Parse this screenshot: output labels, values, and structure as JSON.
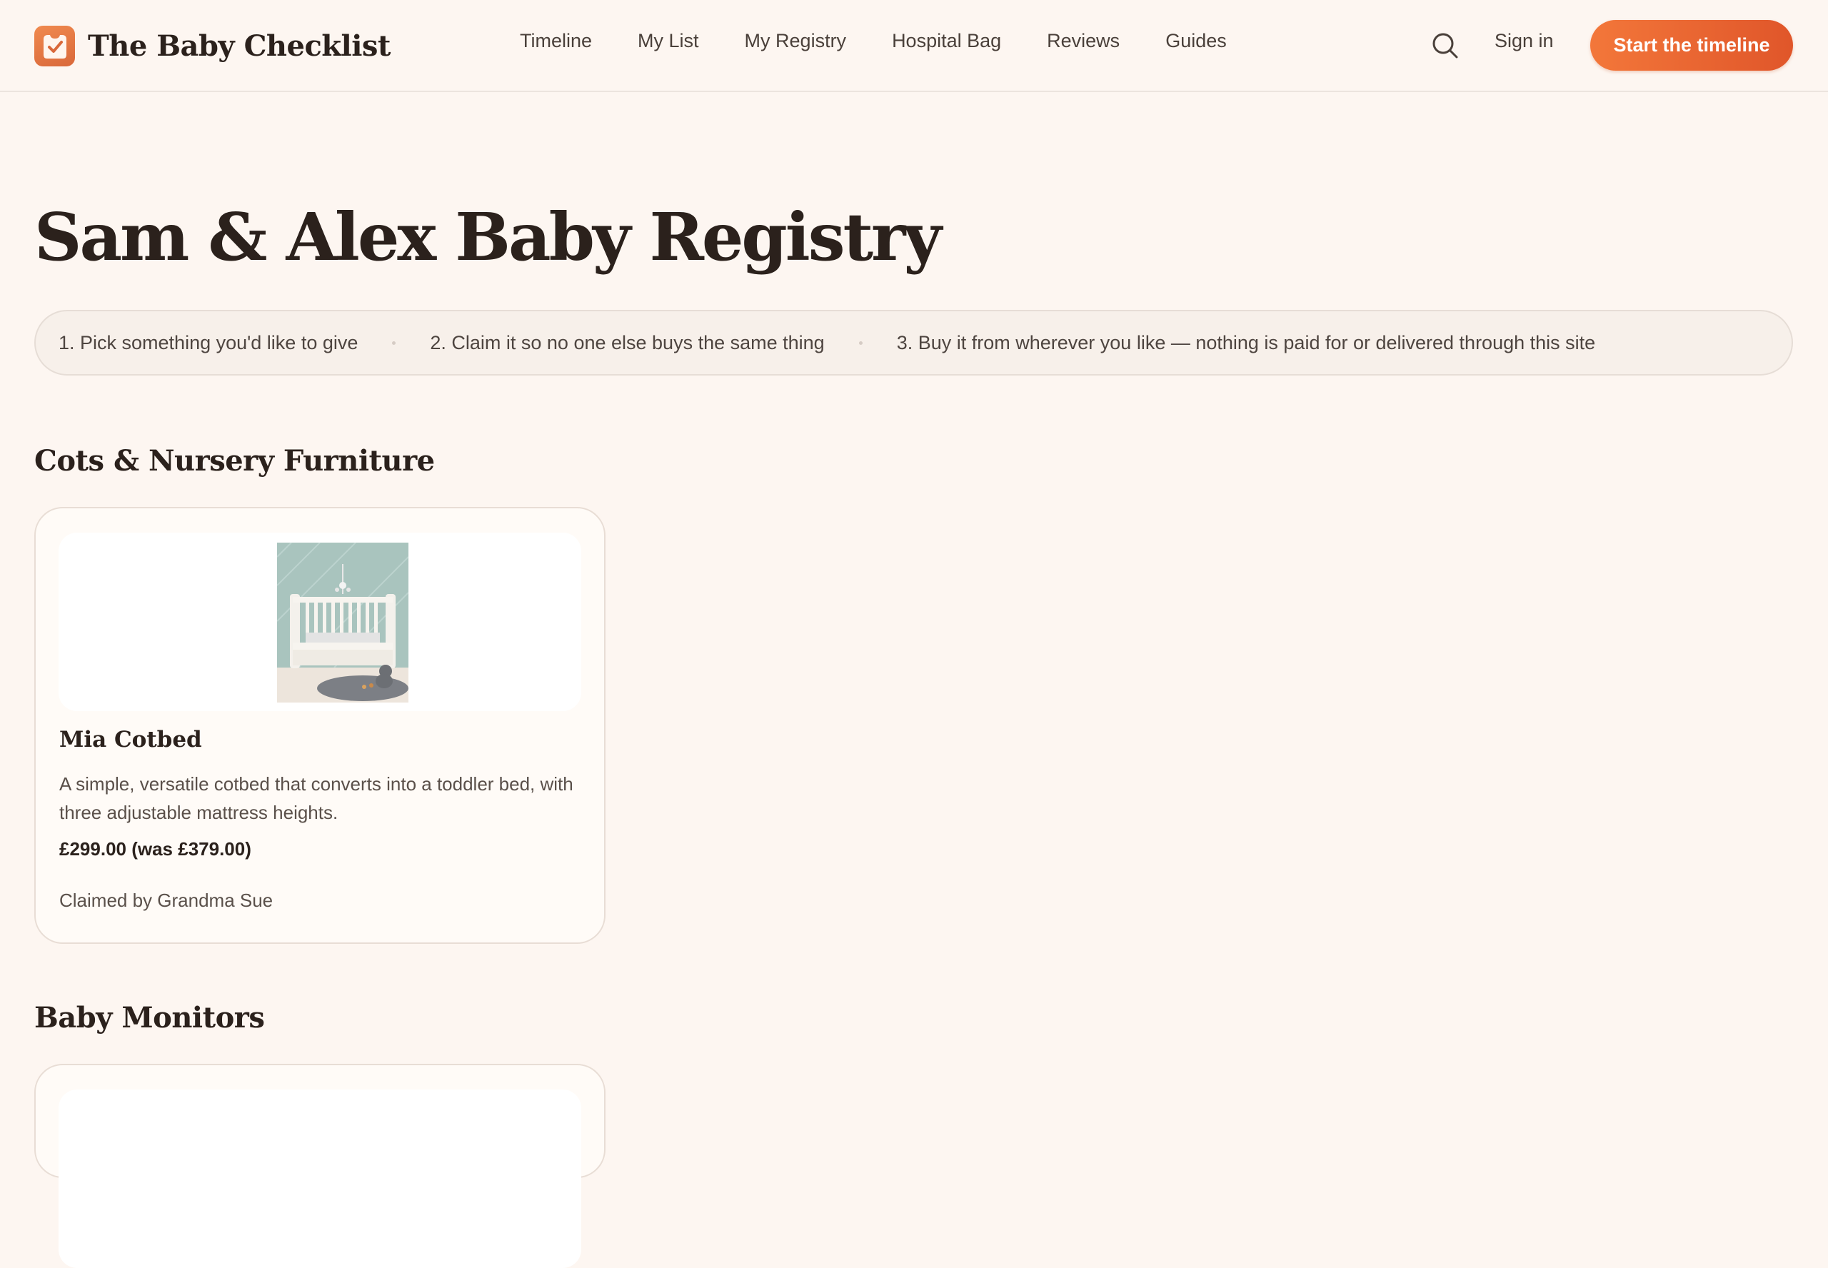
{
  "brand": {
    "name": "The Baby Checklist",
    "accent": "#ee6a32",
    "background": "#fdf6f1"
  },
  "nav": {
    "items": [
      "Timeline",
      "My List",
      "My Registry",
      "Hospital Bag",
      "Reviews",
      "Guides"
    ],
    "search_icon": "search-icon",
    "signin_label": "Sign in",
    "cta_label": "Start the timeline"
  },
  "page": {
    "title": "Sam & Alex Baby Registry",
    "steps": [
      "1. Pick something you'd like to give",
      "2. Claim it so no one else buys the same thing",
      "3. Buy it from wherever you like — nothing is paid for or delivered through this site"
    ]
  },
  "sections": [
    {
      "title": "Cots & Nursery Furniture",
      "items": [
        {
          "name": "Mia Cotbed",
          "description": "A simple, versatile cotbed that converts into a toddler bed, with three adjustable mattress heights.",
          "price": "£299.00 (was £379.00)",
          "status": "Claimed by Grandma Sue"
        }
      ]
    },
    {
      "title": "Baby Monitors",
      "items": []
    }
  ]
}
